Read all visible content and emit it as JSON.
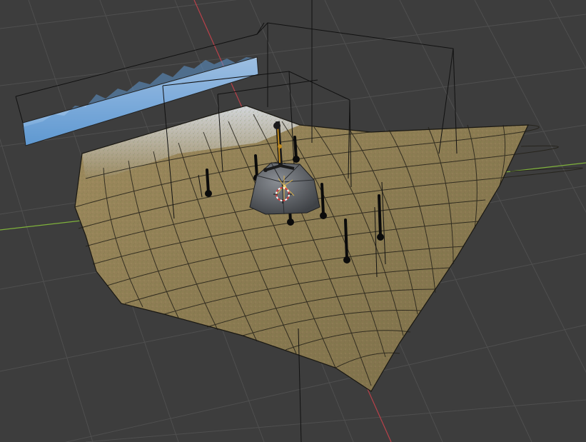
{
  "viewport": {
    "mode": "3d-viewport",
    "background_color": "#3d3d3d",
    "grid_color": "#4f4f4f",
    "x_axis_color": "#b9414a",
    "y_axis_color": "#7fb23b",
    "ground_color": "#8c7a4f",
    "wireframe_color": "#111111",
    "sky_color": "#6fa9da",
    "object_colors": {
      "crane": "#c08a1f",
      "dome": "#505358"
    }
  },
  "scene": {
    "objects": [
      {
        "name": "terrain-plane",
        "icon": "mesh-icon"
      },
      {
        "name": "sky-backdrop",
        "icon": "image-icon"
      },
      {
        "name": "crane-model",
        "icon": "armature-icon"
      },
      {
        "name": "rock-dome",
        "icon": "mesh-icon"
      },
      {
        "name": "light-emitter",
        "icon": "light-icon"
      },
      {
        "name": "3d-cursor",
        "icon": "cursor-icon"
      }
    ]
  }
}
